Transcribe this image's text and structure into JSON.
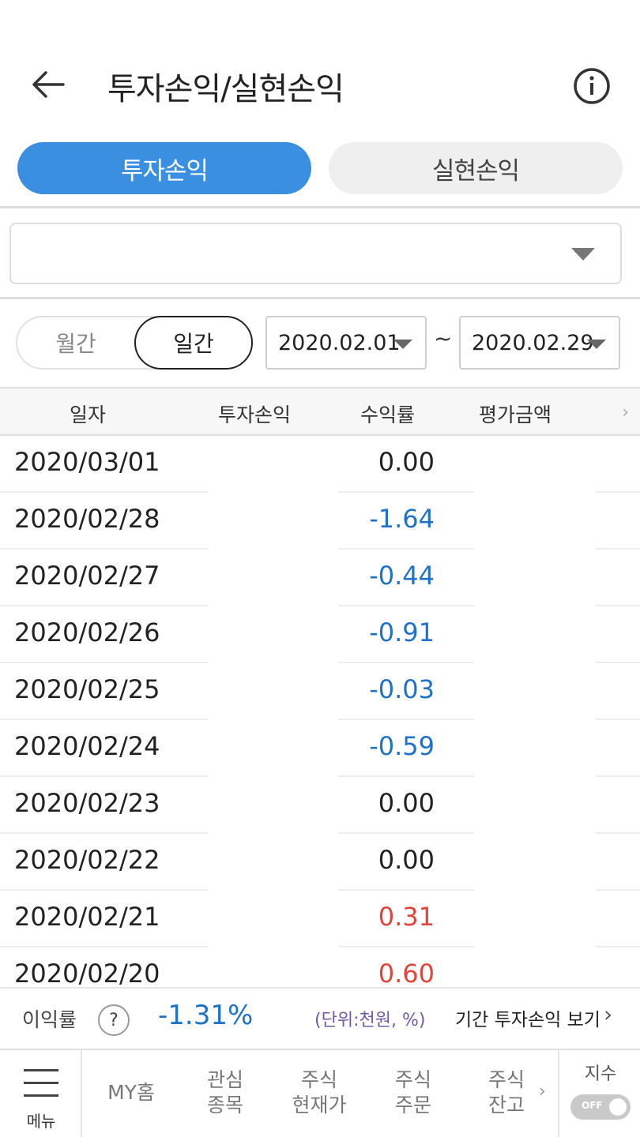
{
  "header": {
    "title": "투자손익/실현손익"
  },
  "tabs": [
    {
      "label": "투자손익",
      "active": true
    },
    {
      "label": "실현손익",
      "active": false
    }
  ],
  "account_select": {
    "value": ""
  },
  "period": {
    "monthly": "월간",
    "daily": "일간",
    "selected": "일간"
  },
  "dates": {
    "start": "2020.02.01",
    "separator": "~",
    "end": "2020.02.29"
  },
  "table": {
    "columns": [
      "일자",
      "투자손익",
      "수익률",
      "평가금액"
    ],
    "more": "›",
    "rows": [
      {
        "date": "2020/03/01",
        "rate": "0.00",
        "trend": "flat"
      },
      {
        "date": "2020/02/28",
        "rate": "-1.64",
        "trend": "down"
      },
      {
        "date": "2020/02/27",
        "rate": "-0.44",
        "trend": "down"
      },
      {
        "date": "2020/02/26",
        "rate": "-0.91",
        "trend": "down"
      },
      {
        "date": "2020/02/25",
        "rate": "-0.03",
        "trend": "down"
      },
      {
        "date": "2020/02/24",
        "rate": "-0.59",
        "trend": "down"
      },
      {
        "date": "2020/02/23",
        "rate": "0.00",
        "trend": "flat"
      },
      {
        "date": "2020/02/22",
        "rate": "0.00",
        "trend": "flat"
      },
      {
        "date": "2020/02/21",
        "rate": "0.31",
        "trend": "up"
      },
      {
        "date": "2020/02/20",
        "rate": "0.60",
        "trend": "up"
      }
    ]
  },
  "summary": {
    "label": "이익률",
    "help": "?",
    "rate": "-1.31%",
    "unit": "(단위:천원, %)",
    "link": "기간 투자손익 보기",
    "link_chevron": "›"
  },
  "bottom_nav": {
    "menu": "메뉴",
    "items": [
      {
        "label": "MY홈"
      },
      {
        "label": "관심\n종목"
      },
      {
        "label": "주식\n현재가"
      },
      {
        "label": "주식\n주문"
      },
      {
        "label": "주식\n잔고"
      }
    ],
    "more": "›",
    "index_label": "지수",
    "index_toggle": "OFF"
  },
  "colors": {
    "accent": "#3a8fe0",
    "down": "#1e73c8",
    "up": "#e0453a",
    "flat": "#222222"
  }
}
